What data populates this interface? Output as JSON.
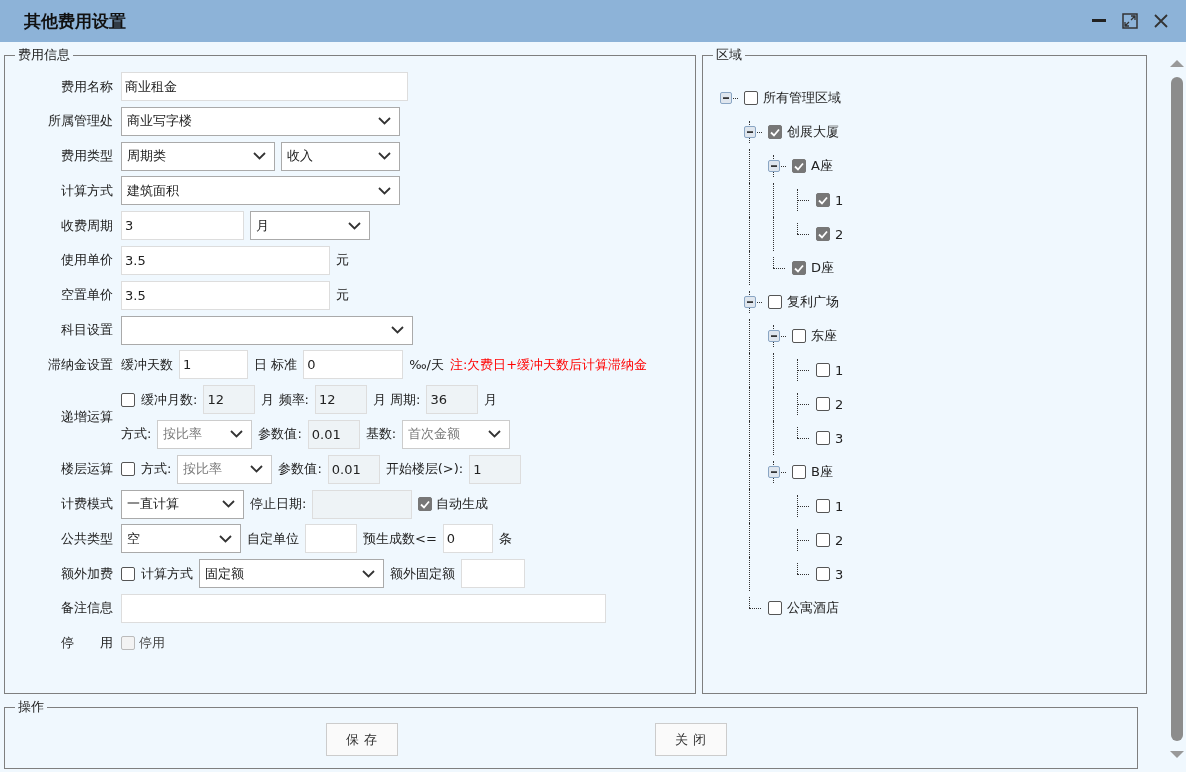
{
  "window": {
    "title": "其他费用设置"
  },
  "fee_info": {
    "legend": "费用信息",
    "rows": [
      {
        "label": "费用名称",
        "lines": [
          [
            {
              "kind": "input",
              "value": "商业租金"
            }
          ]
        ]
      },
      {
        "label": "所属管理处",
        "lines": [
          [
            {
              "kind": "select",
              "value": "商业写字楼"
            }
          ]
        ]
      },
      {
        "label": "费用类型",
        "lines": [
          [
            {
              "kind": "select",
              "value": "周期类"
            },
            {
              "kind": "select",
              "value": "收入"
            }
          ]
        ]
      },
      {
        "label": "计算方式",
        "lines": [
          [
            {
              "kind": "select",
              "value": "建筑面积"
            }
          ]
        ]
      },
      {
        "label": "收费周期",
        "lines": [
          [
            {
              "kind": "input",
              "value": "3"
            },
            {
              "kind": "select",
              "value": "月"
            }
          ]
        ]
      },
      {
        "label": "使用单价",
        "lines": [
          [
            {
              "kind": "input",
              "value": "3.5"
            },
            {
              "kind": "text",
              "text": "元"
            }
          ]
        ]
      },
      {
        "label": "空置单价",
        "lines": [
          [
            {
              "kind": "input",
              "value": "3.5"
            },
            {
              "kind": "text",
              "text": "元"
            }
          ]
        ]
      },
      {
        "label": "科目设置",
        "lines": [
          [
            {
              "kind": "select"
            }
          ]
        ]
      },
      {
        "label": "滞纳金设置",
        "lines": [
          [
            {
              "kind": "text",
              "text": "缓冲天数"
            },
            {
              "kind": "input",
              "value": "1"
            },
            {
              "kind": "text",
              "text": "日 标准"
            },
            {
              "kind": "input",
              "value": "0"
            },
            {
              "kind": "text",
              "text": "‰/天"
            },
            {
              "kind": "note",
              "text": "注:欠费日+缓冲天数后计算滞纳金"
            }
          ]
        ]
      },
      {
        "label": "递增运算",
        "lines": [
          [
            {
              "kind": "checkbox",
              "checked": false,
              "disabled": false
            },
            {
              "kind": "text",
              "text": "缓冲月数:"
            },
            {
              "kind": "input",
              "value": "12",
              "disabled": true
            },
            {
              "kind": "text",
              "text": "月 频率:"
            },
            {
              "kind": "input",
              "value": "12",
              "disabled": true
            },
            {
              "kind": "text",
              "text": "月 周期:"
            },
            {
              "kind": "input",
              "value": "36",
              "disabled": true
            },
            {
              "kind": "text",
              "text": "月"
            }
          ],
          [
            {
              "kind": "text",
              "text": "方式:"
            },
            {
              "kind": "select",
              "value": "按比率",
              "disabled": true
            },
            {
              "kind": "text",
              "text": "参数值:"
            },
            {
              "kind": "input",
              "value": "0.01",
              "disabled": true
            },
            {
              "kind": "text",
              "text": "基数:"
            },
            {
              "kind": "select",
              "value": "首次金额",
              "disabled": true
            }
          ]
        ]
      },
      {
        "label": "楼层运算",
        "lines": [
          [
            {
              "kind": "checkbox",
              "checked": false,
              "disabled": false
            },
            {
              "kind": "text",
              "text": "方式:"
            },
            {
              "kind": "select",
              "value": "按比率",
              "disabled": true
            },
            {
              "kind": "text",
              "text": "参数值:"
            },
            {
              "kind": "input",
              "value": "0.01",
              "disabled": true
            },
            {
              "kind": "text",
              "text": "开始楼层(>):"
            },
            {
              "kind": "input",
              "value": "1",
              "disabled": true
            }
          ]
        ]
      },
      {
        "label": "计费模式",
        "lines": [
          [
            {
              "kind": "select",
              "value": "一直计算"
            },
            {
              "kind": "text",
              "text": "停止日期:"
            },
            {
              "kind": "input",
              "disabled": true
            },
            {
              "kind": "checkbox",
              "checked": true,
              "disabled": false,
              "label": "自动生成"
            }
          ]
        ]
      },
      {
        "label": "公共类型",
        "lines": [
          [
            {
              "kind": "select",
              "value": "空"
            },
            {
              "kind": "text",
              "text": "自定单位"
            },
            {
              "kind": "input"
            },
            {
              "kind": "text",
              "text": "预生成数<="
            },
            {
              "kind": "input",
              "value": "0"
            },
            {
              "kind": "text",
              "text": "条"
            }
          ]
        ]
      },
      {
        "label": "额外加费",
        "lines": [
          [
            {
              "kind": "checkbox",
              "checked": false,
              "disabled": false
            },
            {
              "kind": "text",
              "text": "计算方式"
            },
            {
              "kind": "select",
              "value": "固定额"
            },
            {
              "kind": "text",
              "text": "额外固定额"
            },
            {
              "kind": "input"
            }
          ]
        ]
      },
      {
        "label": "备注信息",
        "lines": [
          [
            {
              "kind": "input"
            }
          ]
        ]
      },
      {
        "label": "停　　用",
        "lines": [
          [
            {
              "kind": "checkbox",
              "checked": false,
              "disabled": true,
              "label": "停用"
            }
          ]
        ]
      }
    ]
  },
  "area": {
    "legend": "区域",
    "tree": [
      {
        "label": "所有管理区域",
        "checked": false,
        "expanded": true,
        "children": [
          {
            "label": "创展大厦",
            "checked": true,
            "expanded": true,
            "children": [
              {
                "label": "A座",
                "checked": true,
                "expanded": true,
                "children": [
                  {
                    "label": "1",
                    "checked": true
                  },
                  {
                    "label": "2",
                    "checked": true
                  }
                ]
              },
              {
                "label": "D座",
                "checked": true
              }
            ]
          },
          {
            "label": "复利广场",
            "checked": false,
            "expanded": true,
            "children": [
              {
                "label": "东座",
                "checked": false,
                "expanded": true,
                "children": [
                  {
                    "label": "1",
                    "checked": false
                  },
                  {
                    "label": "2",
                    "checked": false
                  },
                  {
                    "label": "3",
                    "checked": false
                  }
                ]
              },
              {
                "label": "B座",
                "checked": false,
                "expanded": true,
                "children": [
                  {
                    "label": "1",
                    "checked": false
                  },
                  {
                    "label": "2",
                    "checked": false
                  },
                  {
                    "label": "3",
                    "checked": false
                  }
                ]
              }
            ]
          },
          {
            "label": "公寓酒店",
            "checked": false
          }
        ]
      }
    ]
  },
  "actions": {
    "legend": "操作",
    "buttons": [
      "保 存",
      "关 闭"
    ]
  }
}
